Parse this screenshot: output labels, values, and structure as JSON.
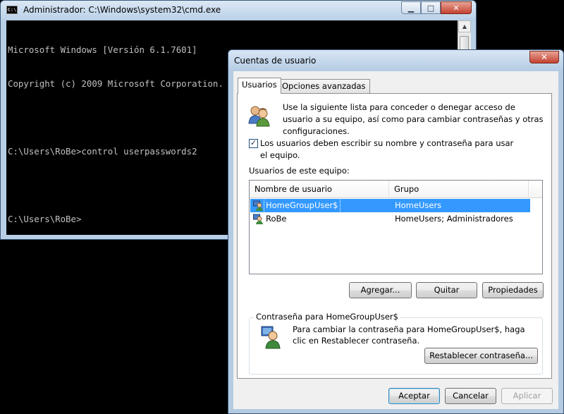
{
  "cmd": {
    "title": "Administrador: C:\\Windows\\system32\\cmd.exe",
    "icon_text": "C:\\",
    "lines": [
      "Microsoft Windows [Versión 6.1.7601]",
      "Copyright (c) 2009 Microsoft Corporation. Reservados todos los derechos.",
      "",
      "C:\\Users\\RoBe>control userpasswords2",
      "",
      "C:\\Users\\RoBe>"
    ]
  },
  "dialog": {
    "title": "Cuentas de usuario",
    "close_glyph": "✕",
    "tabs": [
      "Usuarios",
      "Opciones avanzadas"
    ],
    "intro": "Use la siguiente lista para conceder o denegar acceso de usuario a su equipo, así como para cambiar contraseñas y otras configuraciones.",
    "checkbox": {
      "checked": true,
      "label": "Los usuarios deben escribir su nombre y contraseña para usar el equipo."
    },
    "list_label": "Usuarios de este equipo:",
    "columns": [
      "Nombre de usuario",
      "Grupo"
    ],
    "users": [
      {
        "name": "HomeGroupUser$",
        "group": "HomeUsers",
        "selected": true
      },
      {
        "name": "RoBe",
        "group": "HomeUsers; Administradores",
        "selected": false
      }
    ],
    "buttons": {
      "add": "Agregar...",
      "remove": "Quitar",
      "properties": "Propiedades"
    },
    "password_group": {
      "title": "Contraseña para HomeGroupUser$",
      "text": "Para cambiar la contraseña para HomeGroupUser$, haga clic en Restablecer contraseña.",
      "reset_button": "Restablecer contraseña..."
    },
    "footer": {
      "ok": "Aceptar",
      "cancel": "Cancelar",
      "apply": "Aplicar"
    },
    "colors": {
      "selection": "#3399ff",
      "titlebar": "#b6cde5",
      "console_bg": "#000000",
      "console_text": "#c0c0c0"
    }
  }
}
